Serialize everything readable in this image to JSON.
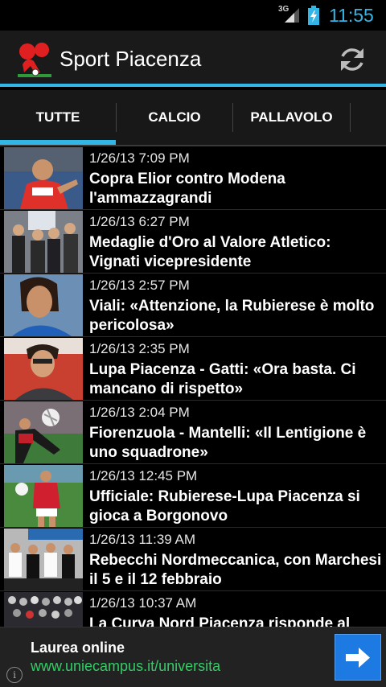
{
  "status_bar": {
    "network": "3G",
    "time": "11:55",
    "icons": [
      "signal-icon",
      "battery-charging-icon"
    ]
  },
  "action_bar": {
    "title": "Sport Piacenza",
    "logo_text": "SP",
    "refresh_icon": "refresh-icon"
  },
  "tabs": {
    "items": [
      "TUTTE",
      "CALCIO",
      "PALLAVOLO"
    ],
    "selected": "TUTTE"
  },
  "news": [
    {
      "date": "1/26/13 7:09 PM",
      "title": "Copra Elior contro Modena l'ammazzagrandi"
    },
    {
      "date": "1/26/13 6:27 PM",
      "title": "Medaglie d'Oro al Valore Atletico: Vignati vicepresidente"
    },
    {
      "date": "1/26/13 2:57 PM",
      "title": "Viali: «Attenzione, la Rubierese è molto pericolosa»"
    },
    {
      "date": "1/26/13 2:35 PM",
      "title": "Lupa Piacenza - Gatti: «Ora basta. Ci mancano di rispetto»"
    },
    {
      "date": "1/26/13 2:04 PM",
      "title": "Fiorenzuola - Mantelli: «Il Lentigione è uno squadrone»"
    },
    {
      "date": "1/26/13 12:45 PM",
      "title": "Ufficiale: Rubierese-Lupa Piacenza si gioca a Borgonovo"
    },
    {
      "date": "1/26/13 11:39 AM",
      "title": "Rebecchi Nordmeccanica, con Marchesi il 5 e il 12 febbraio"
    },
    {
      "date": "1/26/13 10:37 AM",
      "title": "La Curva Nord Piacenza risponde al"
    }
  ],
  "ad": {
    "title": "Laurea online",
    "url": "www.uniecampus.it/universita",
    "info_glyph": "i",
    "colors": {
      "url": "#33cc66",
      "button": "#1e7ae3"
    }
  },
  "colors": {
    "accent": "#33b5e5",
    "background": "#000000",
    "action_bar": "#1a1a1a"
  }
}
